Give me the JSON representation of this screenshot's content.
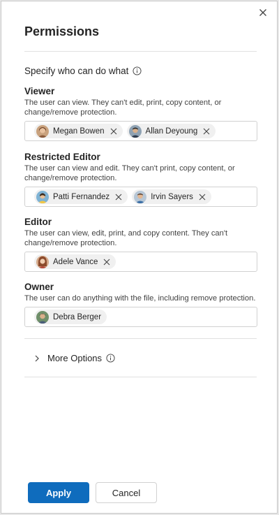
{
  "dialog": {
    "title": "Permissions",
    "specify_label": "Specify who can do what",
    "more_options_label": "More Options",
    "apply_label": "Apply",
    "cancel_label": "Cancel",
    "accent_color": "#0f6cbd"
  },
  "roles": [
    {
      "name": "Viewer",
      "description": "The user can view. They can't edit, print, copy content, or change/remove protection.",
      "people": [
        {
          "name": "Megan Bowen",
          "removable": true
        },
        {
          "name": "Allan Deyoung",
          "removable": true
        }
      ]
    },
    {
      "name": "Restricted Editor",
      "description": "The user can view and edit. They can't print, copy content, or change/remove protection.",
      "people": [
        {
          "name": "Patti Fernandez",
          "removable": true
        },
        {
          "name": "Irvin Sayers",
          "removable": true
        }
      ]
    },
    {
      "name": "Editor",
      "description": "The user can view, edit, print, and copy content. They can't change/remove protection.",
      "people": [
        {
          "name": "Adele Vance",
          "removable": true
        }
      ]
    },
    {
      "name": "Owner",
      "description": "The user can do anything with the file, including remove protection.",
      "people": [
        {
          "name": "Debra Berger",
          "removable": false
        }
      ]
    }
  ],
  "icons": {
    "close": "close-icon",
    "info": "info-icon",
    "chevron": "chevron-right-icon",
    "remove": "dismiss-icon"
  }
}
